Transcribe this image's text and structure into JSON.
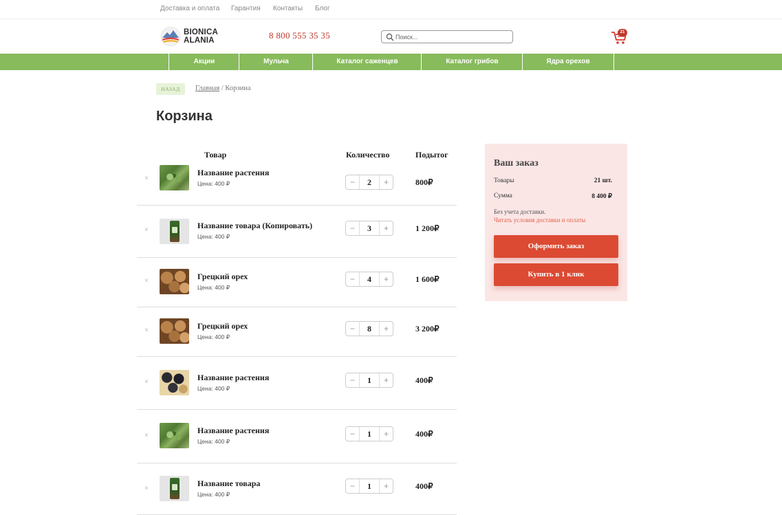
{
  "top_links": [
    "Доставка и оплата",
    "Гарантия",
    "Контакты",
    "Блог"
  ],
  "logo": {
    "line1": "BIONICA",
    "line2": "ALANIA"
  },
  "phone": "8 800 555 35 35",
  "search": {
    "placeholder": "Поиск..."
  },
  "cart": {
    "count": "21",
    "icon": "cart-icon"
  },
  "nav": [
    "Акции",
    "Мульча",
    "Каталог саженцев",
    "Каталог грибов",
    "Ядра орехов"
  ],
  "breadcrumb": {
    "back": "НАЗАД",
    "home": "Главная",
    "separator": " / ",
    "current": "Корзина"
  },
  "page_title": "Корзина",
  "table": {
    "headers": {
      "product": "Товар",
      "quantity": "Количество",
      "subtotal": "Подытог"
    },
    "remove_symbol": "×",
    "minus_symbol": "−",
    "plus_symbol": "+",
    "rows": [
      {
        "name": "Название растения",
        "price": "Цена: 400 ₽",
        "qty": "2",
        "subtotal": "800₽",
        "thumb": "plant"
      },
      {
        "name": "Название товара (Копировать)",
        "price": "Цена: 400 ₽",
        "qty": "3",
        "subtotal": "1 200₽",
        "thumb": "bag"
      },
      {
        "name": "Грецкий орех",
        "price": "Цена: 400 ₽",
        "qty": "4",
        "subtotal": "1 600₽",
        "thumb": "nut"
      },
      {
        "name": "Грецкий орех",
        "price": "Цена: 400 ₽",
        "qty": "8",
        "subtotal": "3 200₽",
        "thumb": "nut"
      },
      {
        "name": "Название растения",
        "price": "Цена: 400 ₽",
        "qty": "1",
        "subtotal": "400₽",
        "thumb": "berry"
      },
      {
        "name": "Название растения",
        "price": "Цена: 400 ₽",
        "qty": "1",
        "subtotal": "400₽",
        "thumb": "plant"
      },
      {
        "name": "Название товара",
        "price": "Цена: 400 ₽",
        "qty": "1",
        "subtotal": "400₽",
        "thumb": "bag"
      }
    ]
  },
  "summary": {
    "title": "Ваш заказ",
    "items_label": "Товары",
    "items_value": "21 шт.",
    "sum_label": "Сумма",
    "sum_value": "8 400 ₽",
    "note": "Без учета доставки.",
    "link": "Читать условия доставки и оплаты",
    "checkout": "Оформить заказ",
    "one_click": "Купить в 1 клик"
  },
  "colors": {
    "accent_green": "#88bb5c",
    "accent_red": "#dc4a33",
    "summary_bg": "#fbe6e6",
    "phone_red": "#c0392b"
  }
}
